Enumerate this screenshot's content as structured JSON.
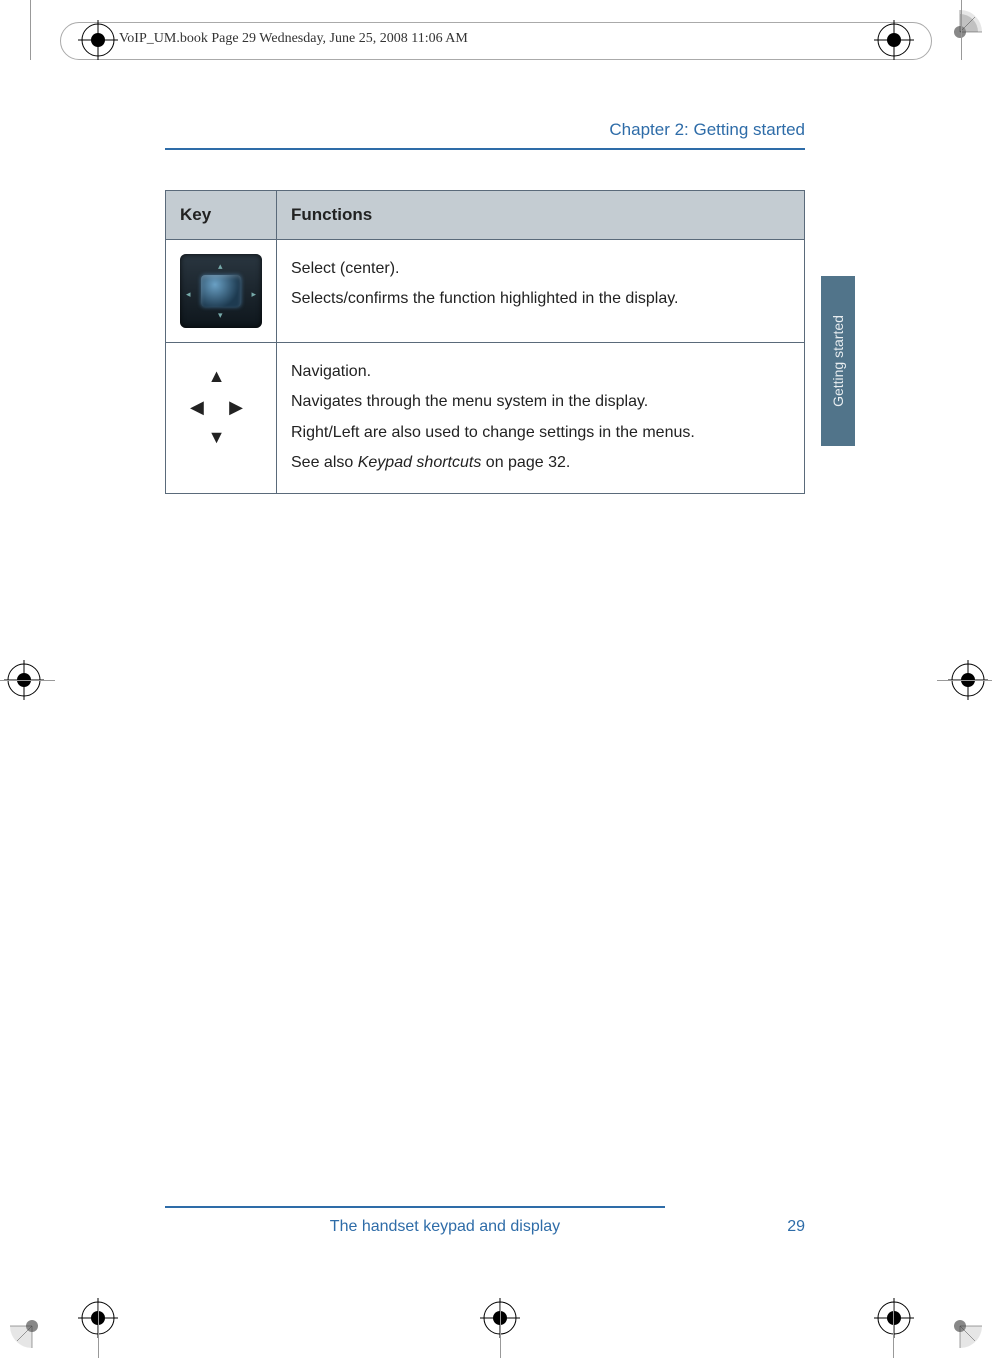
{
  "header": {
    "running_head": "VoIP_UM.book  Page 29  Wednesday, June 25, 2008  11:06 AM"
  },
  "chapter": {
    "label": "Chapter 2:  Getting started"
  },
  "side_tab": {
    "label": "Getting started"
  },
  "table": {
    "th_key": "Key",
    "th_functions": "Functions",
    "rows": [
      {
        "key_glyph": "select-center-button",
        "lines": {
          "l1": "Select (center).",
          "l2": "Selects/confirms the function highlighted in the display."
        }
      },
      {
        "key_glyph": "navigation-arrows",
        "lines": {
          "l1": "Navigation.",
          "l2": "Navigates through the menu system in the display.",
          "l3": "Right/Left are also used to change settings in the menus.",
          "l4a": "See also ",
          "l4b": "Keypad shortcuts",
          "l4c": " on page 32."
        }
      }
    ]
  },
  "nav_glyphs": {
    "up": "▲",
    "left": "◀",
    "right": "▶",
    "down": "▼"
  },
  "footer": {
    "caption": "The handset keypad and display",
    "page": "29"
  }
}
